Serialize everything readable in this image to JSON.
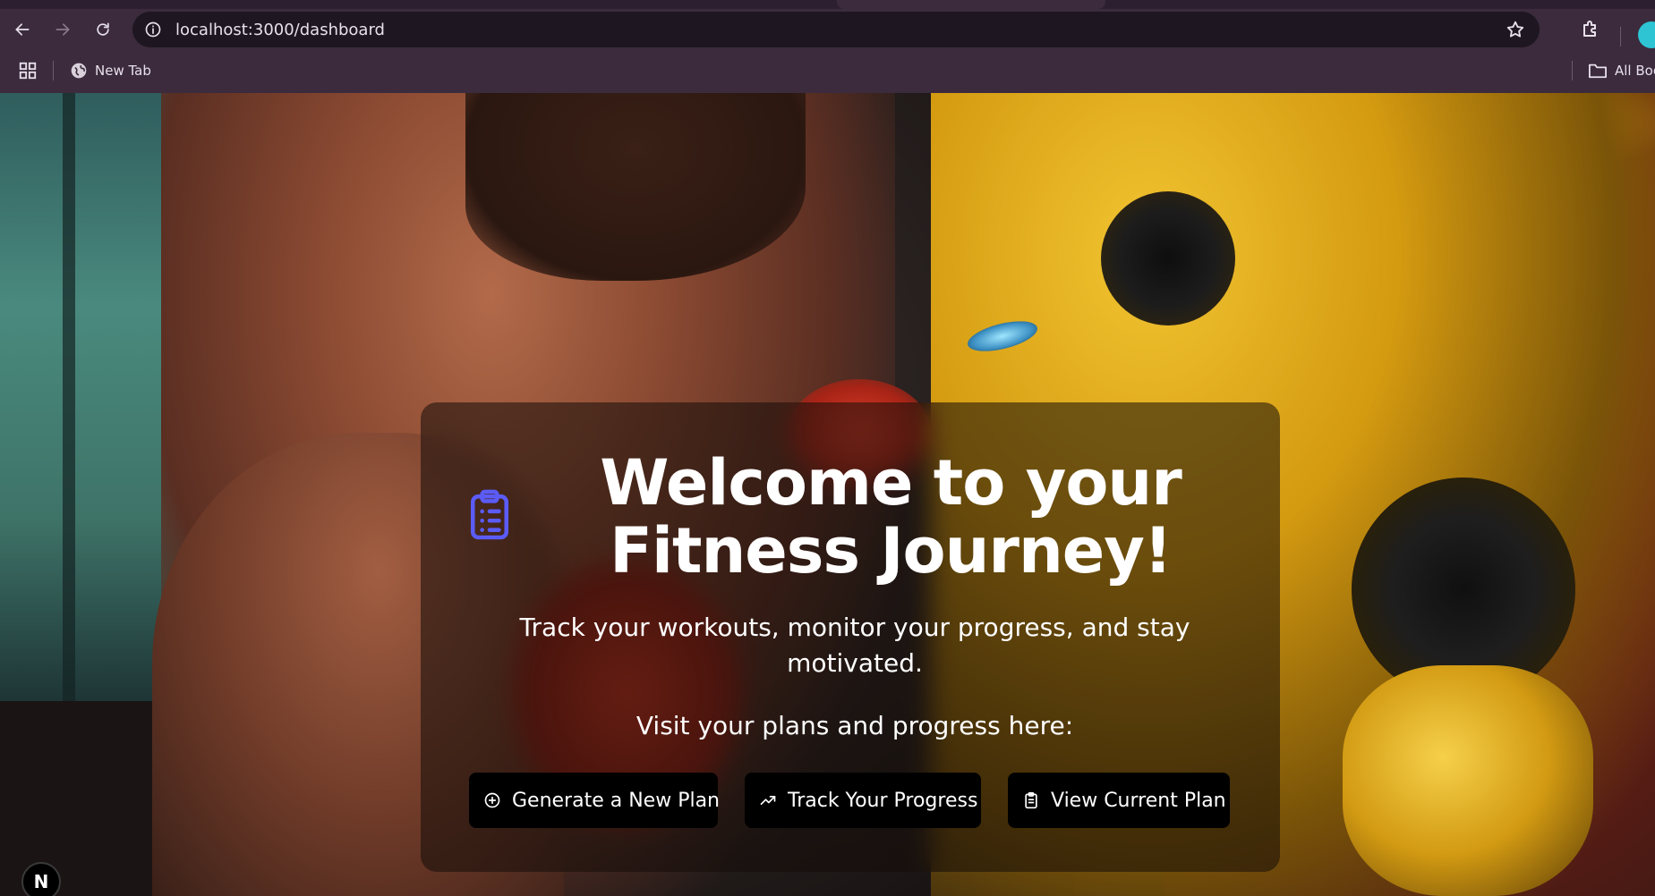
{
  "browser": {
    "url": "localhost:3000/dashboard",
    "bookmark_item": "New Tab",
    "all_bookmarks": "All Boo"
  },
  "hero": {
    "title": "Welcome to your Fitness Journey!",
    "subtitle": "Track your workouts, monitor your progress, and stay motivated.",
    "visit_text": "Visit your plans and progress here:"
  },
  "actions": {
    "generate_label": "Generate a New Plan",
    "track_label": "Track Your Progress",
    "view_label": "View Current Plan"
  },
  "badge": {
    "label": "N"
  },
  "colors": {
    "accent_icon": "#5b5bf5",
    "button_bg": "#000000",
    "chrome_bg": "#3b2b3d"
  },
  "icons": {
    "hero": "clipboard-list-icon",
    "generate": "plus-circle-icon",
    "track": "trending-up-icon",
    "view": "clipboard-icon"
  }
}
